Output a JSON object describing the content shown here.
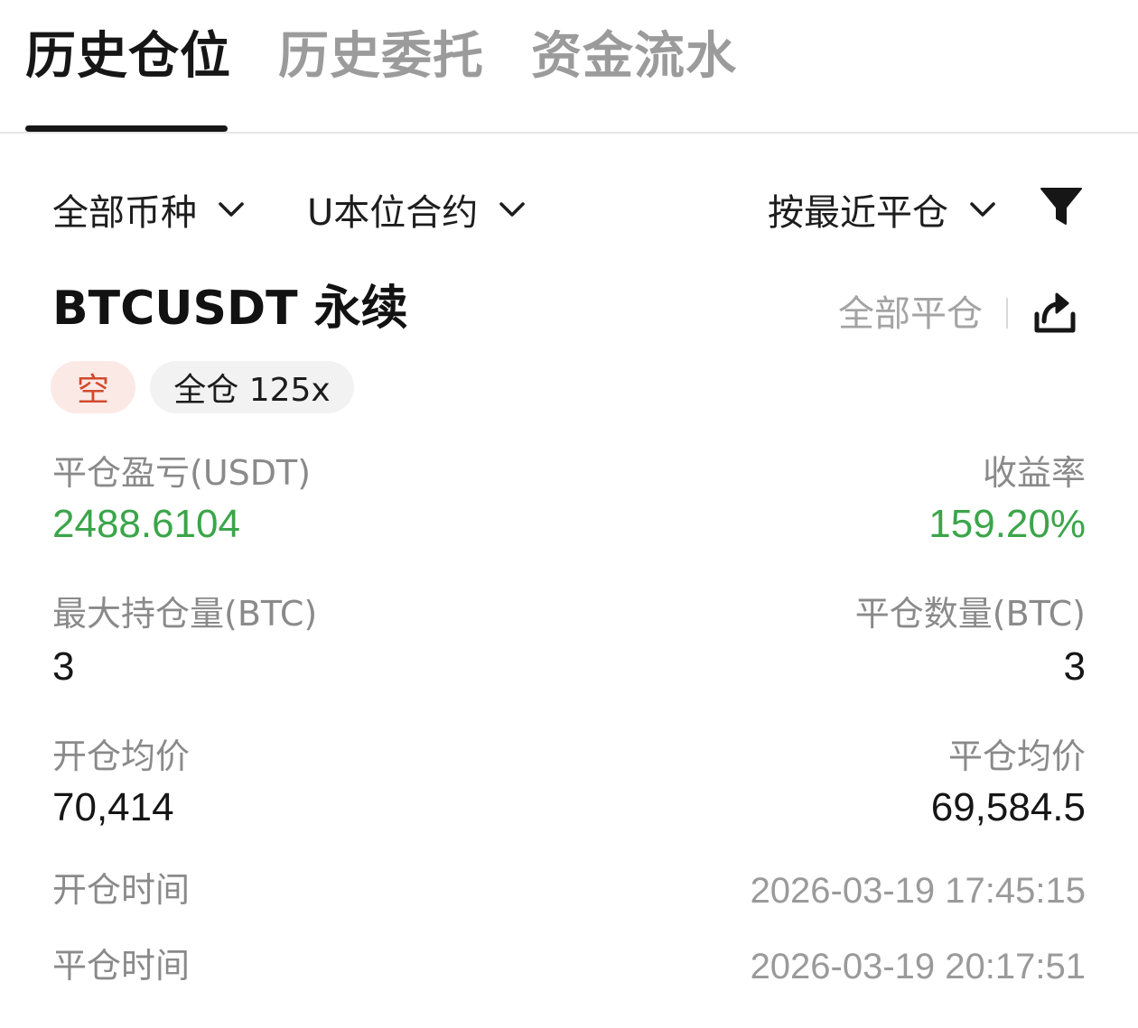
{
  "tabs": [
    {
      "label": "历史仓位",
      "active": true
    },
    {
      "label": "历史委托",
      "active": false
    },
    {
      "label": "资金流水",
      "active": false
    }
  ],
  "filters": {
    "coin": "全部币种",
    "contract": "U本位合约",
    "sort": "按最近平仓"
  },
  "position": {
    "symbol": "BTCUSDT 永续",
    "close_all": "全部平仓",
    "side_badge": "空",
    "margin_badge": "全仓 125x",
    "pnl_label": "平仓盈亏(USDT)",
    "pnl_value": "2488.6104",
    "roi_label": "收益率",
    "roi_value": "159.20%",
    "max_qty_label": "最大持仓量(BTC)",
    "max_qty_value": "3",
    "close_qty_label": "平仓数量(BTC)",
    "close_qty_value": "3",
    "open_price_label": "开仓均价",
    "open_price_value": "70,414",
    "close_price_label": "平仓均价",
    "close_price_value": "69,584.5",
    "open_time_label": "开仓时间",
    "open_time_value": "2026-03-19 17:45:15",
    "close_time_label": "平仓时间",
    "close_time_value": "2026-03-19 20:17:51"
  },
  "colors": {
    "profit": "#3ba54a",
    "short": "#d24a2d",
    "short_bg": "#fbe9e6"
  },
  "icons": [
    "chevron-down-icon",
    "filter-icon",
    "share-icon"
  ]
}
